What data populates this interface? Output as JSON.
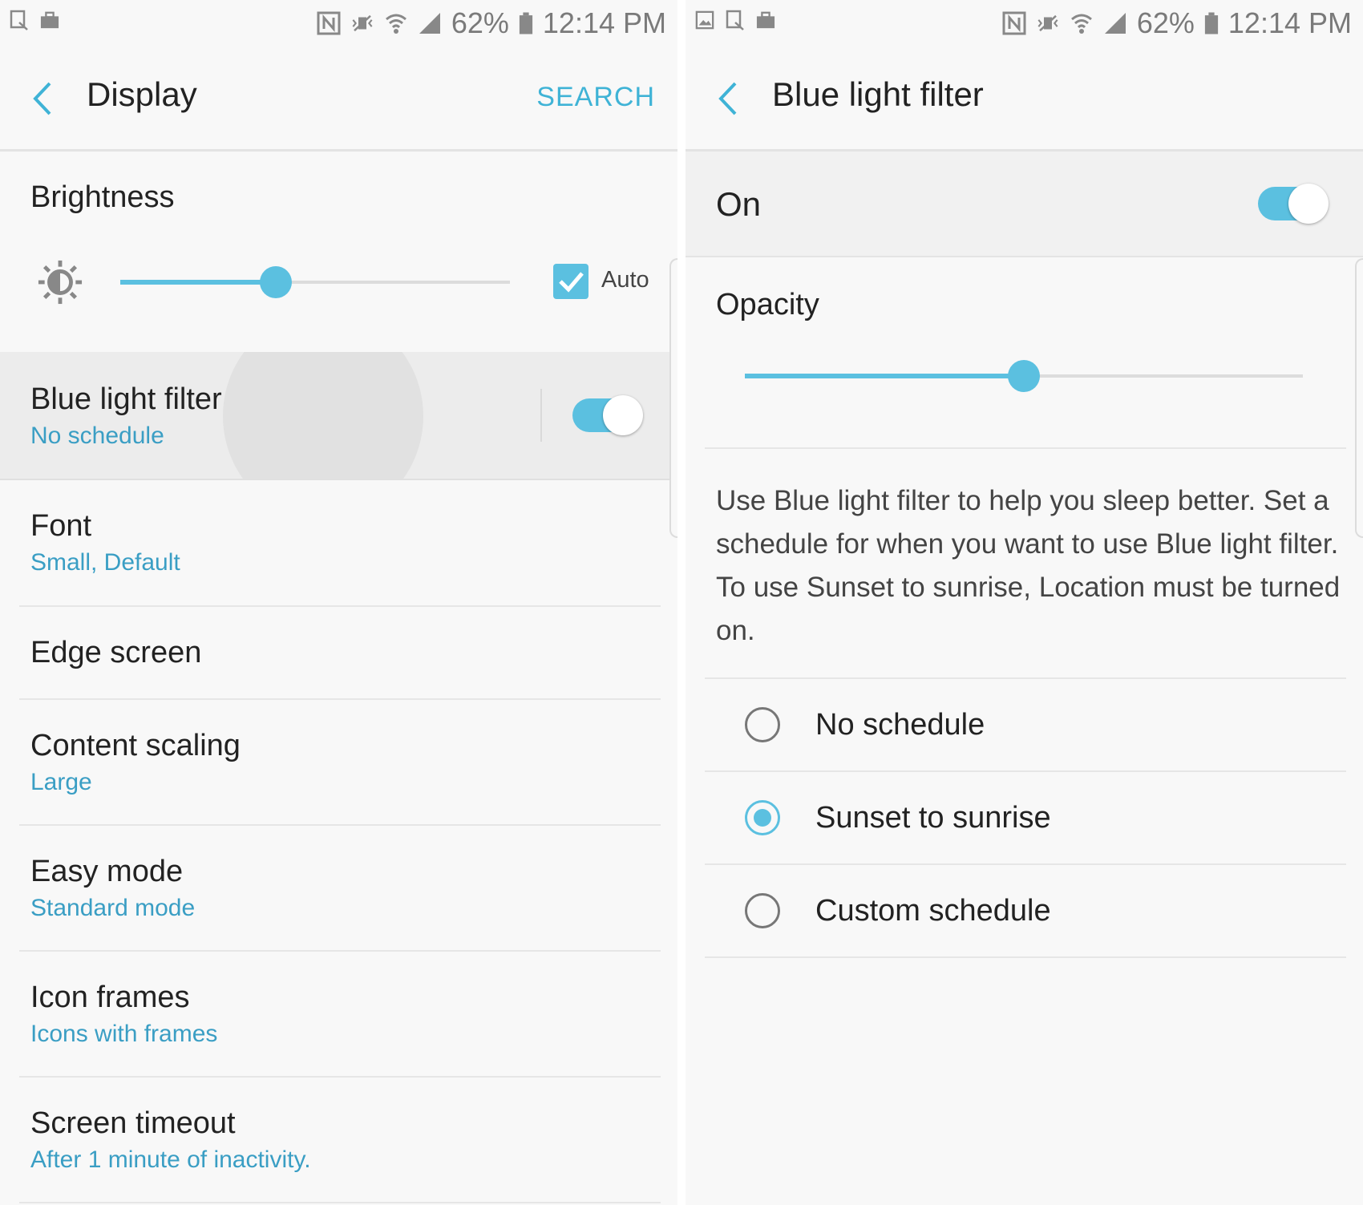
{
  "status_bar": {
    "battery": "62%",
    "time": "12:14 PM"
  },
  "display_screen": {
    "title": "Display",
    "search_label": "SEARCH",
    "brightness": {
      "title": "Brightness",
      "level": 0.4,
      "auto_label": "Auto",
      "auto_checked": true
    },
    "items": [
      {
        "title": "Blue light filter",
        "subtitle": "No schedule",
        "toggle_on": true
      },
      {
        "title": "Font",
        "subtitle": "Small, Default"
      },
      {
        "title": "Edge screen",
        "subtitle": ""
      },
      {
        "title": "Content scaling",
        "subtitle": "Large"
      },
      {
        "title": "Easy mode",
        "subtitle": "Standard mode"
      },
      {
        "title": "Icon frames",
        "subtitle": "Icons with frames"
      },
      {
        "title": "Screen timeout",
        "subtitle": "After 1 minute of inactivity."
      }
    ]
  },
  "blue_light_screen": {
    "title": "Blue light filter",
    "master_label": "On",
    "master_on": true,
    "opacity_label": "Opacity",
    "opacity_level": 0.5,
    "description": "Use Blue light filter to help you sleep better. Set a schedule for when you want to use Blue light filter. To use Sunset to sunrise, Location must be turned on.",
    "schedule_options": [
      {
        "label": "No schedule",
        "selected": false
      },
      {
        "label": "Sunset to sunrise",
        "selected": true
      },
      {
        "label": "Custom schedule",
        "selected": false
      }
    ]
  },
  "colors": {
    "accent": "#5bc0e0",
    "subtitle": "#3a9ec4",
    "background": "#f8f8f8"
  }
}
